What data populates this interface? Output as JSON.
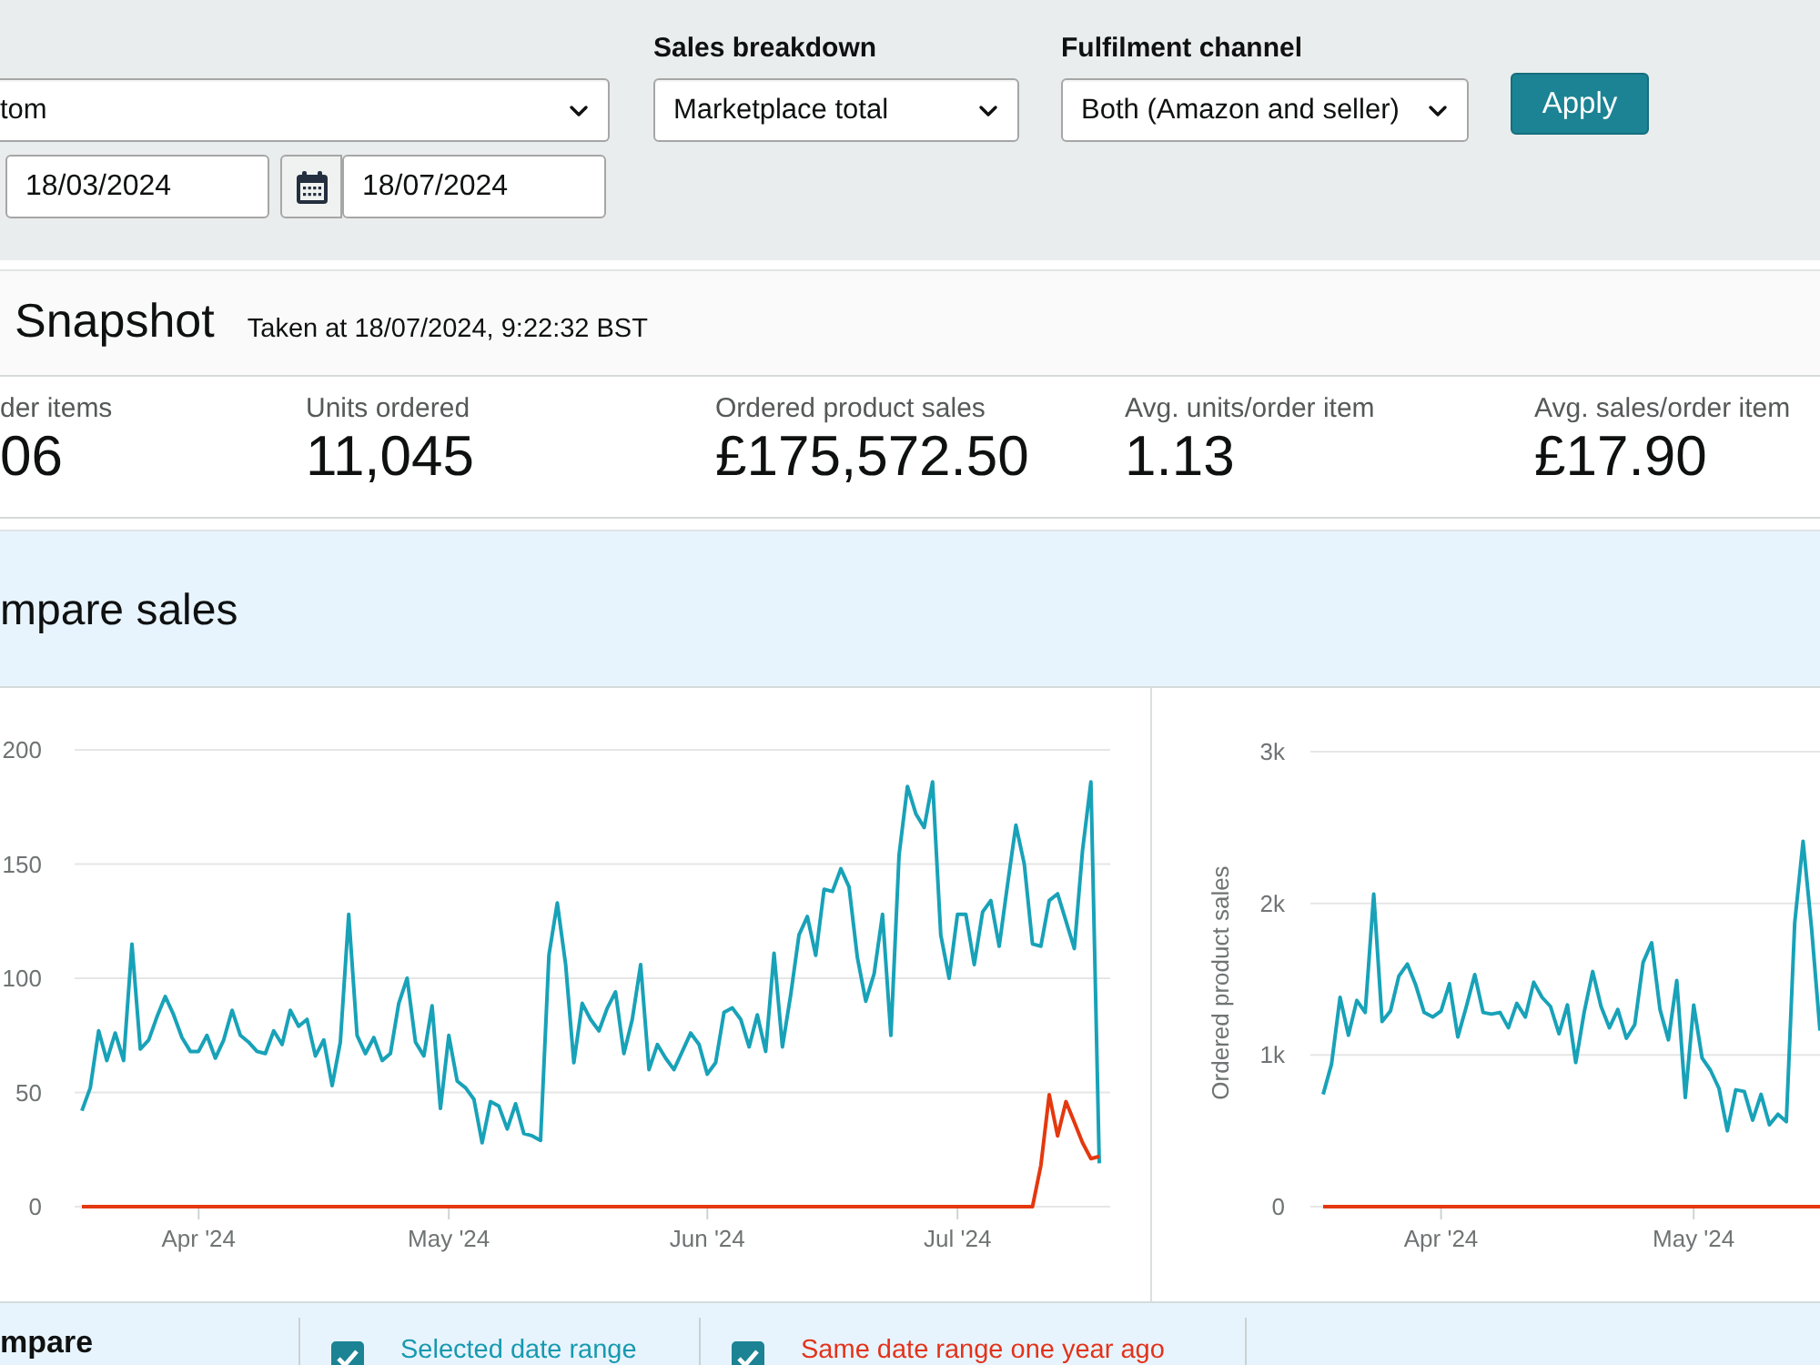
{
  "filters": {
    "date_range": {
      "value": "tom",
      "start_date": "18/03/2024",
      "end_date": "18/07/2024"
    },
    "sales_breakdown": {
      "label": "Sales breakdown",
      "value": "Marketplace total"
    },
    "fulfilment_channel": {
      "label": "Fulfilment channel",
      "value": "Both (Amazon and seller)"
    },
    "apply_button": "Apply"
  },
  "snapshot": {
    "title": "Snapshot",
    "taken_at": "Taken at 18/07/2024, 9:22:32 BST",
    "metrics": [
      {
        "label": "der items",
        "value": "06"
      },
      {
        "label": "Units ordered",
        "value": "11,045"
      },
      {
        "label": "Ordered product sales",
        "value": "£175,572.50"
      },
      {
        "label": "Avg. units/order item",
        "value": "1.13"
      },
      {
        "label": "Avg. sales/order item",
        "value": "£17.90"
      }
    ]
  },
  "compare_sales": {
    "title": "mpare sales",
    "charts": [
      {
        "chart_data": {
          "type": "line",
          "grid": true,
          "categories": [
            null,
            null,
            null,
            null,
            null,
            null,
            null,
            null,
            null,
            null,
            null,
            null,
            null,
            null,
            "Apr '24",
            null,
            null,
            null,
            null,
            null,
            null,
            null,
            null,
            null,
            null,
            null,
            null,
            null,
            null,
            null,
            null,
            null,
            null,
            null,
            null,
            null,
            null,
            null,
            null,
            null,
            null,
            null,
            null,
            null,
            "May '24",
            null,
            null,
            null,
            null,
            null,
            null,
            null,
            null,
            null,
            null,
            null,
            null,
            null,
            null,
            null,
            null,
            null,
            null,
            null,
            null,
            null,
            null,
            null,
            null,
            null,
            null,
            null,
            null,
            null,
            null,
            "Jun '24",
            null,
            null,
            null,
            null,
            null,
            null,
            null,
            null,
            null,
            null,
            null,
            null,
            null,
            null,
            null,
            null,
            null,
            null,
            null,
            null,
            null,
            null,
            null,
            null,
            null,
            null,
            null,
            null,
            null,
            "Jul '24",
            null,
            null,
            null,
            null,
            null,
            null,
            null,
            null,
            null,
            null,
            null,
            null,
            null,
            null,
            null,
            null,
            null
          ],
          "ylim": [
            0,
            200
          ],
          "yticks": [
            0,
            50,
            100,
            150,
            200
          ],
          "series": [
            {
              "color": "#18a2b8",
              "values": [
                42,
                52,
                77,
                64,
                76,
                64,
                115,
                69,
                73,
                83,
                92,
                84,
                74,
                68,
                68,
                75,
                65,
                73,
                86,
                75,
                72,
                68,
                67,
                77,
                71,
                86,
                79,
                82,
                66,
                73,
                53,
                72,
                128,
                75,
                67,
                74,
                64,
                67,
                89,
                100,
                72,
                66,
                88,
                43,
                75,
                55,
                52,
                47,
                28,
                46,
                44,
                34,
                45,
                32,
                31,
                29,
                110,
                133,
                106,
                63,
                89,
                82,
                77,
                87,
                94,
                67,
                82,
                106,
                60,
                71,
                65,
                60,
                68,
                76,
                71,
                58,
                63,
                85,
                87,
                82,
                70,
                84,
                68,
                111,
                70,
                93,
                119,
                127,
                110,
                139,
                138,
                148,
                140,
                109,
                90,
                102,
                128,
                75,
                154,
                184,
                172,
                166,
                186,
                119,
                100,
                128,
                128,
                106,
                129,
                134,
                114,
                141,
                167,
                150,
                115,
                114,
                134,
                137,
                125,
                113,
                156,
                186,
                19
              ]
            },
            {
              "color": "#e4380f",
              "values": [
                0,
                0,
                0,
                0,
                0,
                0,
                0,
                0,
                0,
                0,
                0,
                0,
                0,
                0,
                0,
                0,
                0,
                0,
                0,
                0,
                0,
                0,
                0,
                0,
                0,
                0,
                0,
                0,
                0,
                0,
                0,
                0,
                0,
                0,
                0,
                0,
                0,
                0,
                0,
                0,
                0,
                0,
                0,
                0,
                0,
                0,
                0,
                0,
                0,
                0,
                0,
                0,
                0,
                0,
                0,
                0,
                0,
                0,
                0,
                0,
                0,
                0,
                0,
                0,
                0,
                0,
                0,
                0,
                0,
                0,
                0,
                0,
                0,
                0,
                0,
                0,
                0,
                0,
                0,
                0,
                0,
                0,
                0,
                0,
                0,
                0,
                0,
                0,
                0,
                0,
                0,
                0,
                0,
                0,
                0,
                0,
                0,
                0,
                0,
                0,
                0,
                0,
                0,
                0,
                0,
                0,
                0,
                0,
                0,
                0,
                0,
                0,
                0,
                0,
                0,
                18,
                49,
                31,
                46,
                37,
                28,
                21,
                22
              ]
            }
          ]
        }
      },
      {
        "chart_data": {
          "type": "line",
          "grid": true,
          "ylabel": "Ordered product sales",
          "categories": [
            null,
            null,
            null,
            null,
            null,
            null,
            null,
            null,
            null,
            null,
            null,
            null,
            null,
            null,
            "Apr '24",
            null,
            null,
            null,
            null,
            null,
            null,
            null,
            null,
            null,
            null,
            null,
            null,
            null,
            null,
            null,
            null,
            null,
            null,
            null,
            null,
            null,
            null,
            null,
            null,
            null,
            null,
            null,
            null,
            null,
            "May '24",
            null,
            null,
            null,
            null,
            null,
            null,
            null,
            null,
            null,
            null,
            null,
            null,
            null,
            null,
            null
          ],
          "ylim": [
            0,
            3000
          ],
          "yticks": [
            {
              "value": 0,
              "label": "0"
            },
            {
              "value": 1000,
              "label": "1k"
            },
            {
              "value": 2000,
              "label": "2k"
            },
            {
              "value": 3000,
              "label": "3k"
            }
          ],
          "series": [
            {
              "color": "#18a2b8",
              "values": [
                740,
                940,
                1380,
                1130,
                1360,
                1280,
                2060,
                1220,
                1290,
                1520,
                1600,
                1460,
                1280,
                1250,
                1290,
                1470,
                1120,
                1320,
                1530,
                1280,
                1270,
                1280,
                1180,
                1340,
                1250,
                1480,
                1380,
                1320,
                1140,
                1330,
                950,
                1280,
                1550,
                1320,
                1180,
                1300,
                1110,
                1200,
                1610,
                1740,
                1300,
                1100,
                1490,
                720,
                1330,
                980,
                900,
                780,
                500,
                770,
                760,
                570,
                740,
                540,
                610,
                560,
                1870,
                2410,
                1830,
                1160
              ]
            },
            {
              "color": "#e4380f",
              "values": [
                0,
                0,
                0,
                0,
                0,
                0,
                0,
                0,
                0,
                0,
                0,
                0,
                0,
                0,
                0,
                0,
                0,
                0,
                0,
                0,
                0,
                0,
                0,
                0,
                0,
                0,
                0,
                0,
                0,
                0,
                0,
                0,
                0,
                0,
                0,
                0,
                0,
                0,
                0,
                0,
                0,
                0,
                0,
                0,
                0,
                0,
                0,
                0,
                0,
                0,
                0,
                0,
                0,
                0,
                0,
                0,
                0,
                0,
                0,
                0
              ]
            }
          ]
        }
      }
    ],
    "legend": {
      "title": "mpare",
      "items": [
        {
          "label": "Selected date range",
          "checked": true,
          "color": "#1799b0"
        },
        {
          "label": "Same date range one year ago",
          "checked": true,
          "color": "#e3321a"
        }
      ]
    }
  }
}
